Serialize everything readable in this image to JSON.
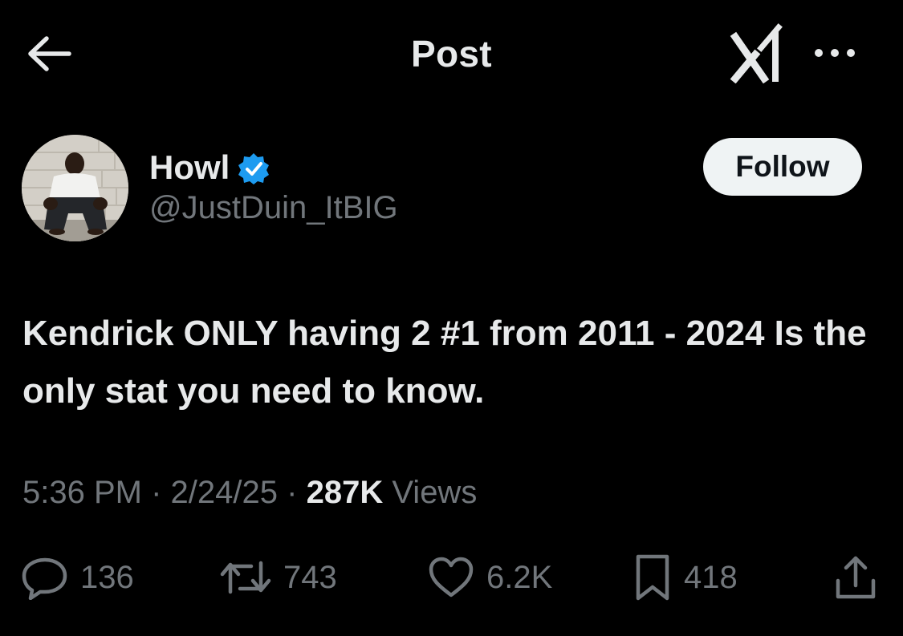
{
  "header": {
    "title": "Post",
    "back_icon": "arrow-left-icon",
    "grok_icon": "grok-logo-icon",
    "more_icon": "more-dots-icon"
  },
  "author": {
    "name": "Howl",
    "handle": "@JustDuin_ItBIG",
    "verified_icon": "verified-badge-icon",
    "verified_color": "#1d9bf0",
    "follow_label": "Follow"
  },
  "post": {
    "text": "Kendrick ONLY having 2 #1 from 2011 - 2024 Is the only stat you need to know."
  },
  "meta": {
    "time": "5:36 PM",
    "separator": "·",
    "date": "2/24/25",
    "views_count": "287K",
    "views_label": "Views"
  },
  "actions": {
    "replies": "136",
    "reposts": "743",
    "likes": "6.2K",
    "bookmarks": "418"
  },
  "colors": {
    "background": "#000000",
    "primary_text": "#e7e9ea",
    "secondary_text": "#71767b",
    "follow_bg": "#eff3f4",
    "follow_text": "#0f1419"
  }
}
